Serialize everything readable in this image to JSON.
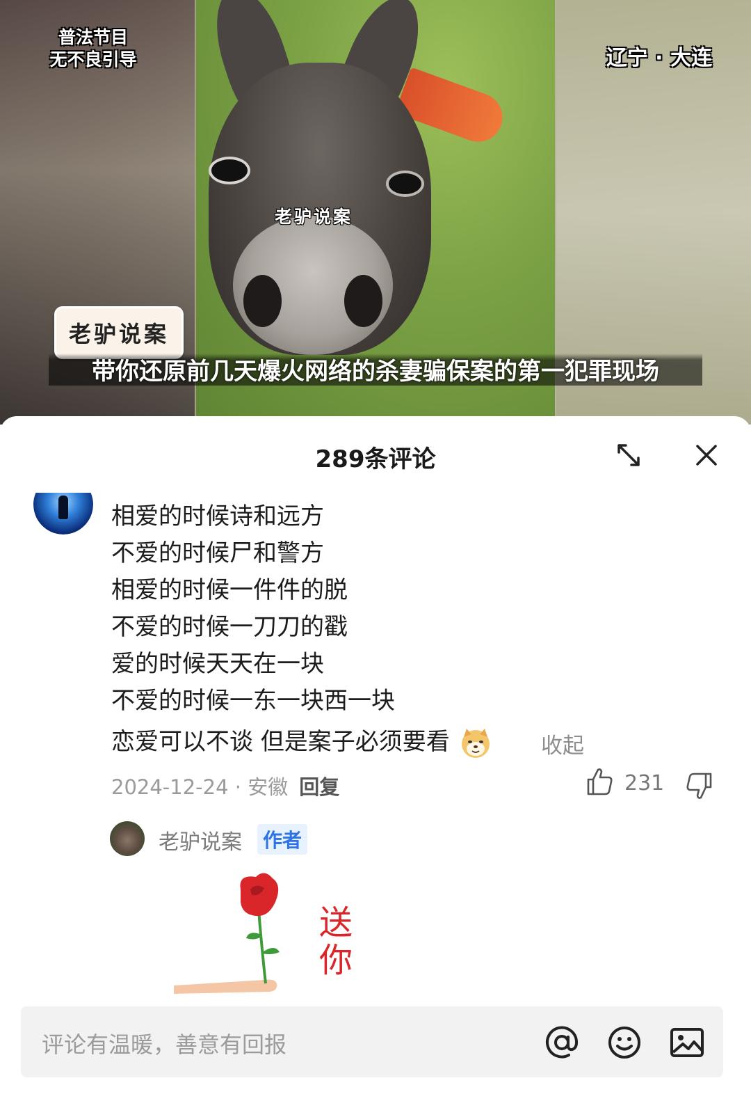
{
  "video": {
    "top_left_tag_line1": "普法节目",
    "top_left_tag_line2": "无不良引导",
    "location": "辽宁 · 大连",
    "watermark": "老驴说案",
    "channel_badge": "老驴说案",
    "subtitle": "带你还原前几天爆火网络的杀妻骗保案的第一犯罪现场"
  },
  "comments_panel": {
    "title": "289条评论",
    "expand_icon": "expand-icon",
    "close_icon": "close-icon"
  },
  "comment": {
    "lines": [
      "相爱的时候诗和远方",
      "不爱的时候尸和警方",
      "相爱的时候一件件的脱",
      "不爱的时候一刀刀的戳",
      "爱的时候天天在一块",
      "不爱的时候一东一块西一块"
    ],
    "last_line": "恋爱可以不谈 但是案子必须要看",
    "emoji": "doge-emoji",
    "collapse_label": "收起",
    "date": "2024-12-24",
    "separator": " · ",
    "region": "安徽",
    "reply_label": "回复",
    "like_count": "231"
  },
  "reply": {
    "author_name": "老驴说案",
    "author_tag": "作者",
    "sticker_text": "送你一"
  },
  "input_bar": {
    "placeholder": "评论有温暖，善意有回报",
    "icons": [
      "at-icon",
      "emoji-icon",
      "image-icon"
    ]
  },
  "colors": {
    "accent_blue": "#2e74e6",
    "tag_bg": "#e8f2ff",
    "rose_red": "#d8262b"
  }
}
